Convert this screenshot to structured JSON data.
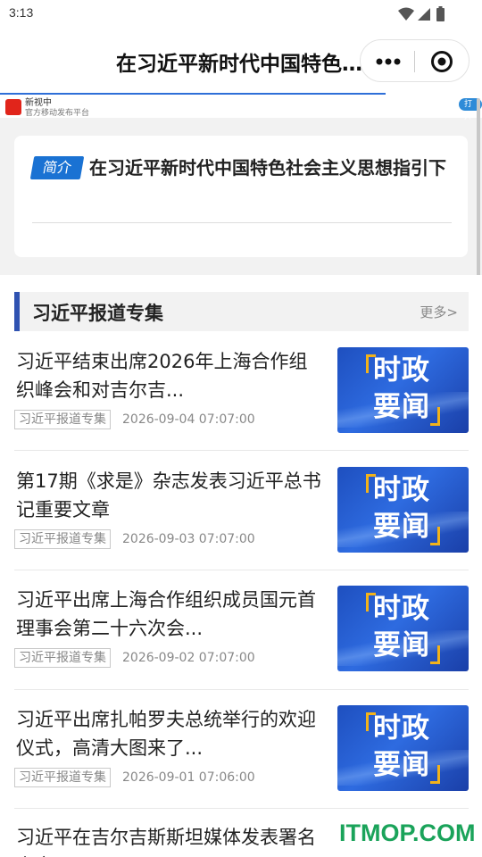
{
  "status": {
    "time": "3:13"
  },
  "nav": {
    "title": "在习近平新时代中国特色社会主义思想指引下"
  },
  "brand": {
    "name": "新视中",
    "subtitle": "官方移动发布平台",
    "open_label": "打开"
  },
  "intro": {
    "tag": "简介",
    "title": "在习近平新时代中国特色社会主义思想指引下"
  },
  "section": {
    "title": "习近平报道专集",
    "more": "更多>"
  },
  "thumb_text": {
    "line1": "时政",
    "line2": "要闻"
  },
  "items": [
    {
      "title": "习近平结束出席2026年上海合作组织峰会和对吉尔吉...",
      "tag": "习近平报道专集",
      "date": "2026-09-04 07:07:00"
    },
    {
      "title": "第17期《求是》杂志发表习近平总书记重要文章",
      "tag": "习近平报道专集",
      "date": "2026-09-03 07:07:00"
    },
    {
      "title": "习近平出席上海合作组织成员国元首理事会第二十六次会...",
      "tag": "习近平报道专集",
      "date": "2026-09-02 07:07:00"
    },
    {
      "title": "习近平出席扎帕罗夫总统举行的欢迎仪式，高清大图来了...",
      "tag": "习近平报道专集",
      "date": "2026-09-01 07:06:00"
    },
    {
      "title": "习近平在吉尔吉斯斯坦媒体发表署名文章"
    }
  ],
  "watermark": "ITMOP.COM",
  "colors": {
    "accent": "#2f52b1",
    "tag_blue": "#1a72d3",
    "watermark": "#1aa35a"
  }
}
